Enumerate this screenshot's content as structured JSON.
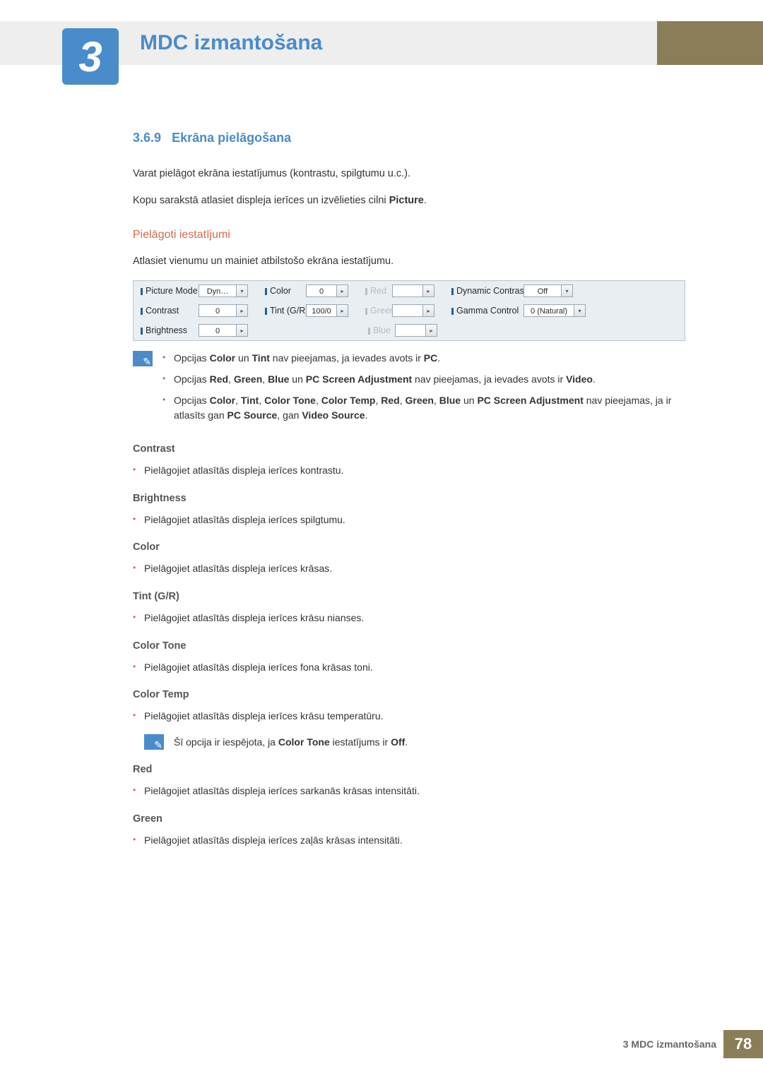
{
  "chapter": {
    "number": "3",
    "title": "MDC izmantošana"
  },
  "section": {
    "number": "3.6.9",
    "title": "Ekrāna pielāgošana"
  },
  "intro": {
    "p1": "Varat pielāgot ekrāna iestatījumus (kontrastu, spilgtumu u.c.).",
    "p2a": "Kopu sarakstā atlasiet displeja ierīces un izvēlieties cilni ",
    "p2b": "Picture",
    "p2c": "."
  },
  "custom": {
    "heading": "Pielāgoti iestatījumi",
    "lead": "Atlasiet vienumu un mainiet atbilstošo ekrāna iestatījumu."
  },
  "panel": {
    "picture_mode_label": "Picture Mode",
    "picture_mode_value": "Dyn…",
    "contrast_label": "Contrast",
    "contrast_value": "0",
    "brightness_label": "Brightness",
    "brightness_value": "0",
    "color_label": "Color",
    "color_value": "0",
    "tint_label": "Tint (G/R)",
    "tint_value": "100/0",
    "red_label": "Red",
    "green_label": "Green",
    "blue_label": "Blue",
    "dyncon_label": "Dynamic Contrast",
    "dyncon_value": "Off",
    "gamma_label": "Gamma Control",
    "gamma_value": "0 (Natural)"
  },
  "notes": [
    "Opcijas Color un Tint nav pieejamas, ja ievades avots ir PC.",
    "Opcijas Red, Green, Blue un PC Screen Adjustment nav pieejamas, ja ievades avots ir Video.",
    "Opcijas Color, Tint, Color Tone, Color Temp, Red, Green, Blue un PC Screen Adjustment nav pieejamas, ja ir atlasīts gan PC Source, gan Video Source."
  ],
  "defs": {
    "contrast": {
      "title": "Contrast",
      "desc": "Pielāgojiet atlasītās displeja ierīces kontrastu."
    },
    "brightness": {
      "title": "Brightness",
      "desc": "Pielāgojiet atlasītās displeja ierīces spilgtumu."
    },
    "color": {
      "title": "Color",
      "desc": "Pielāgojiet atlasītās displeja ierīces krāsas."
    },
    "tint": {
      "title": "Tint (G/R)",
      "desc": "Pielāgojiet atlasītās displeja ierīces krāsu nianses."
    },
    "color_tone": {
      "title": "Color Tone",
      "desc": "Pielāgojiet atlasītās displeja ierīces fona krāsas toni."
    },
    "color_temp": {
      "title": "Color Temp",
      "desc": "Pielāgojiet atlasītās displeja ierīces krāsu temperatūru.",
      "note_a": "Šī opcija ir iespējota, ja ",
      "note_b": "Color Tone",
      "note_c": " iestatījums ir ",
      "note_d": "Off",
      "note_e": "."
    },
    "red": {
      "title": "Red",
      "desc": "Pielāgojiet atlasītās displeja ierīces sarkanās krāsas intensitāti."
    },
    "green": {
      "title": "Green",
      "desc": "Pielāgojiet atlasītās displeja ierīces zaļās krāsas intensitāti."
    }
  },
  "footer": {
    "text": "3 MDC izmantošana",
    "page": "78"
  }
}
